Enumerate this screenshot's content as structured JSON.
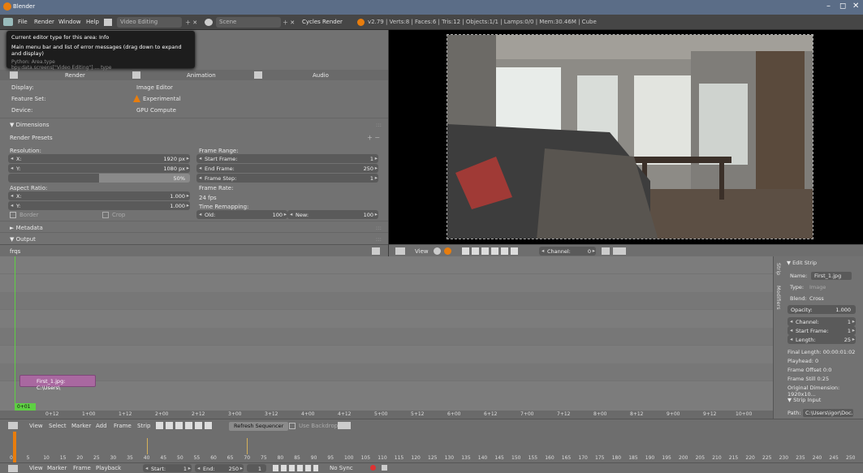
{
  "window": {
    "title": "Blender",
    "min_glyph": "–",
    "max_glyph": "◻",
    "close_glyph": "✕"
  },
  "infobar": {
    "menus": [
      "File",
      "Render",
      "Window",
      "Help"
    ],
    "screen_layout": "Video Editing",
    "scene": "Scene",
    "engine": "Cycles Render",
    "stats": "v2.79 | Verts:8 | Faces:6 | Tris:12 | Objects:1/1 | Lamps:0/0 | Mem:30.46M | Cube"
  },
  "tooltip": {
    "title": "Current editor type for this area:",
    "value": "Info",
    "desc": "Main menu bar and list of error messages (drag down to expand and display)",
    "python1": "Python: Area.type",
    "python2": "bpy.data.screens[\"Video Editing\"] ... type"
  },
  "props": {
    "tabs": [
      "Render",
      "Animation",
      "Audio"
    ],
    "display_label": "Display:",
    "display_value": "Image Editor",
    "featureset_label": "Feature Set:",
    "featureset_value": "Experimental",
    "device_label": "Device:",
    "device_value": "GPU Compute",
    "dimensions_header": "Dimensions",
    "render_presets": "Render Presets",
    "resolution_label": "Resolution:",
    "res_x_label": "X:",
    "res_x": "1920 px",
    "res_y_label": "Y:",
    "res_y": "1080 px",
    "res_pct": "50%",
    "frame_range_label": "Frame Range:",
    "start_label": "Start Frame:",
    "start_value": "1",
    "end_label": "End Frame:",
    "end_value": "250",
    "step_label": "Frame Step:",
    "step_value": "1",
    "aspect_label": "Aspect Ratio:",
    "asp_x_label": "X:",
    "asp_x": "1.000",
    "asp_y_label": "Y:",
    "asp_y": "1.000",
    "frame_rate_label": "Frame Rate:",
    "frame_rate": "24 fps",
    "time_remap_label": "Time Remapping:",
    "old_label": "Old:",
    "old_value": "100",
    "new_label": "New:",
    "new_value": "100",
    "border_label": "Border",
    "crop_label": "Crop",
    "metadata_header": "Metadata",
    "output_header": "Output"
  },
  "sequencer": {
    "strip_label": "First_1.jpg: C:\\Users\\",
    "current_frame": "0+01",
    "ruler": [
      "0+12",
      "1+00",
      "1+12",
      "2+00",
      "2+12",
      "3+00",
      "3+12",
      "4+00",
      "4+12",
      "5+00",
      "5+12",
      "6+00",
      "6+12",
      "7+00",
      "7+12",
      "8+00",
      "8+12",
      "9+00",
      "9+12",
      "10+00"
    ],
    "menus": [
      "View",
      "Select",
      "Marker",
      "Add",
      "Frame",
      "Strip"
    ],
    "refresh_button": "Refresh Sequencer",
    "backdrop_label": "Use Backdrop"
  },
  "preview_header": {
    "view": "View",
    "channel_label": "Channel:",
    "channel_value": "0"
  },
  "side": {
    "edit_strip": "Edit Strip",
    "tab_strip": "Strip",
    "tab_modifiers": "Modifiers",
    "name_label": "Name:",
    "name_value": "First_1.jpg",
    "type_label": "Type:",
    "type_value": "Image",
    "blend_label": "Blend:",
    "blend_value": "Cross",
    "opacity_label": "Opacity:",
    "opacity_value": "1.000",
    "channel_label": "Channel:",
    "channel_value": "1",
    "start_label": "Start Frame:",
    "start_value": "1",
    "length_label": "Length:",
    "length_value": "25",
    "final_length": "Final Length: 00:00:01:02",
    "playhead": "Playhead: 0",
    "frame_offset": "Frame Offset 0:0",
    "frame_still": "Frame Still 0:25",
    "orig_dim": "Original Dimension: 1920x10...",
    "strip_input": "Strip Input",
    "path_label": "Path:",
    "path_value": "C:\\Users\\igor\\Doc..."
  },
  "timeline": {
    "ticks": [
      "0",
      "5",
      "10",
      "15",
      "20",
      "25",
      "30",
      "35",
      "40",
      "45",
      "50",
      "55",
      "60",
      "65",
      "70",
      "75",
      "80",
      "85",
      "90",
      "95",
      "100",
      "105",
      "110",
      "115",
      "120",
      "125",
      "130",
      "135",
      "140",
      "145",
      "150",
      "155",
      "160",
      "165",
      "170",
      "175",
      "180",
      "185",
      "190",
      "195",
      "200",
      "205",
      "210",
      "215",
      "220",
      "225",
      "230",
      "235",
      "240",
      "245",
      "250"
    ],
    "menus": [
      "View",
      "Marker",
      "Frame",
      "Playback"
    ],
    "start_label": "Start:",
    "start_value": "1",
    "end_label": "End:",
    "end_value": "250",
    "current": "1",
    "sync": "No Sync"
  },
  "colors": {
    "accent": "#e87d0d",
    "strip": "#a968a0",
    "playhead": "#5ed043"
  }
}
